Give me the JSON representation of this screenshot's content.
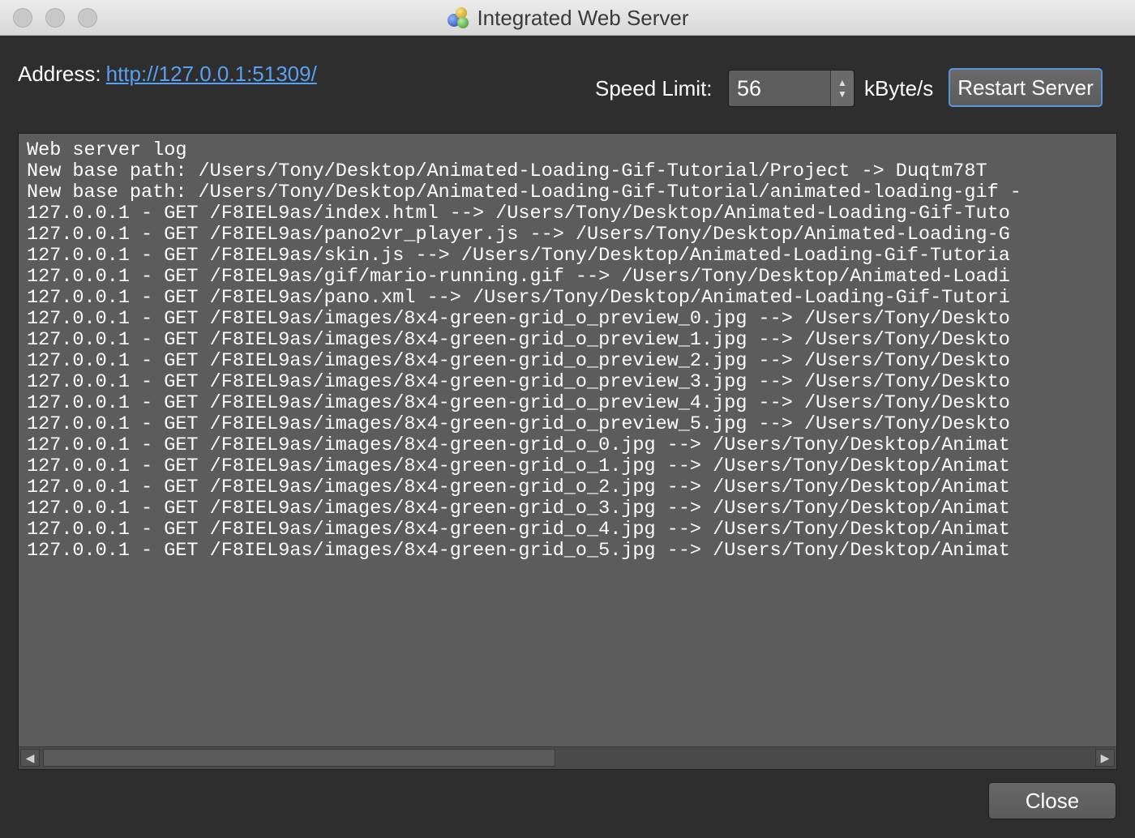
{
  "window": {
    "title": "Integrated Web Server"
  },
  "address": {
    "label": "Address:",
    "url": "http://127.0.0.1:51309/"
  },
  "speed_limit": {
    "label": "Speed Limit:",
    "value": "56",
    "unit": "kByte/s"
  },
  "buttons": {
    "restart": "Restart Server",
    "close": "Close"
  },
  "log": {
    "lines": [
      "Web server log",
      "New base path: /Users/Tony/Desktop/Animated-Loading-Gif-Tutorial/Project -> Duqtm78T",
      "New base path: /Users/Tony/Desktop/Animated-Loading-Gif-Tutorial/animated-loading-gif -",
      "127.0.0.1 - GET /F8IEL9as/index.html --> /Users/Tony/Desktop/Animated-Loading-Gif-Tuto",
      "127.0.0.1 - GET /F8IEL9as/pano2vr_player.js --> /Users/Tony/Desktop/Animated-Loading-G",
      "127.0.0.1 - GET /F8IEL9as/skin.js --> /Users/Tony/Desktop/Animated-Loading-Gif-Tutoria",
      "127.0.0.1 - GET /F8IEL9as/gif/mario-running.gif --> /Users/Tony/Desktop/Animated-Loadi",
      "127.0.0.1 - GET /F8IEL9as/pano.xml --> /Users/Tony/Desktop/Animated-Loading-Gif-Tutori",
      "127.0.0.1 - GET /F8IEL9as/images/8x4-green-grid_o_preview_0.jpg --> /Users/Tony/Deskto",
      "127.0.0.1 - GET /F8IEL9as/images/8x4-green-grid_o_preview_1.jpg --> /Users/Tony/Deskto",
      "127.0.0.1 - GET /F8IEL9as/images/8x4-green-grid_o_preview_2.jpg --> /Users/Tony/Deskto",
      "127.0.0.1 - GET /F8IEL9as/images/8x4-green-grid_o_preview_3.jpg --> /Users/Tony/Deskto",
      "127.0.0.1 - GET /F8IEL9as/images/8x4-green-grid_o_preview_4.jpg --> /Users/Tony/Deskto",
      "127.0.0.1 - GET /F8IEL9as/images/8x4-green-grid_o_preview_5.jpg --> /Users/Tony/Deskto",
      "127.0.0.1 - GET /F8IEL9as/images/8x4-green-grid_o_0.jpg --> /Users/Tony/Desktop/Animat",
      "127.0.0.1 - GET /F8IEL9as/images/8x4-green-grid_o_1.jpg --> /Users/Tony/Desktop/Animat",
      "127.0.0.1 - GET /F8IEL9as/images/8x4-green-grid_o_2.jpg --> /Users/Tony/Desktop/Animat",
      "127.0.0.1 - GET /F8IEL9as/images/8x4-green-grid_o_3.jpg --> /Users/Tony/Desktop/Animat",
      "127.0.0.1 - GET /F8IEL9as/images/8x4-green-grid_o_4.jpg --> /Users/Tony/Desktop/Animat",
      "127.0.0.1 - GET /F8IEL9as/images/8x4-green-grid_o_5.jpg --> /Users/Tony/Desktop/Animat"
    ]
  },
  "icons": {
    "app": "pano2vr-app-icon",
    "stepper_up": "chevron-up-icon",
    "stepper_down": "chevron-down-icon",
    "scroll_left": "arrow-left-icon",
    "scroll_right": "arrow-right-icon"
  },
  "colors": {
    "background": "#2e2e2e",
    "link": "#5aa0f0",
    "focus_ring": "#5a94d8",
    "log_background": "#5c5c5c"
  }
}
